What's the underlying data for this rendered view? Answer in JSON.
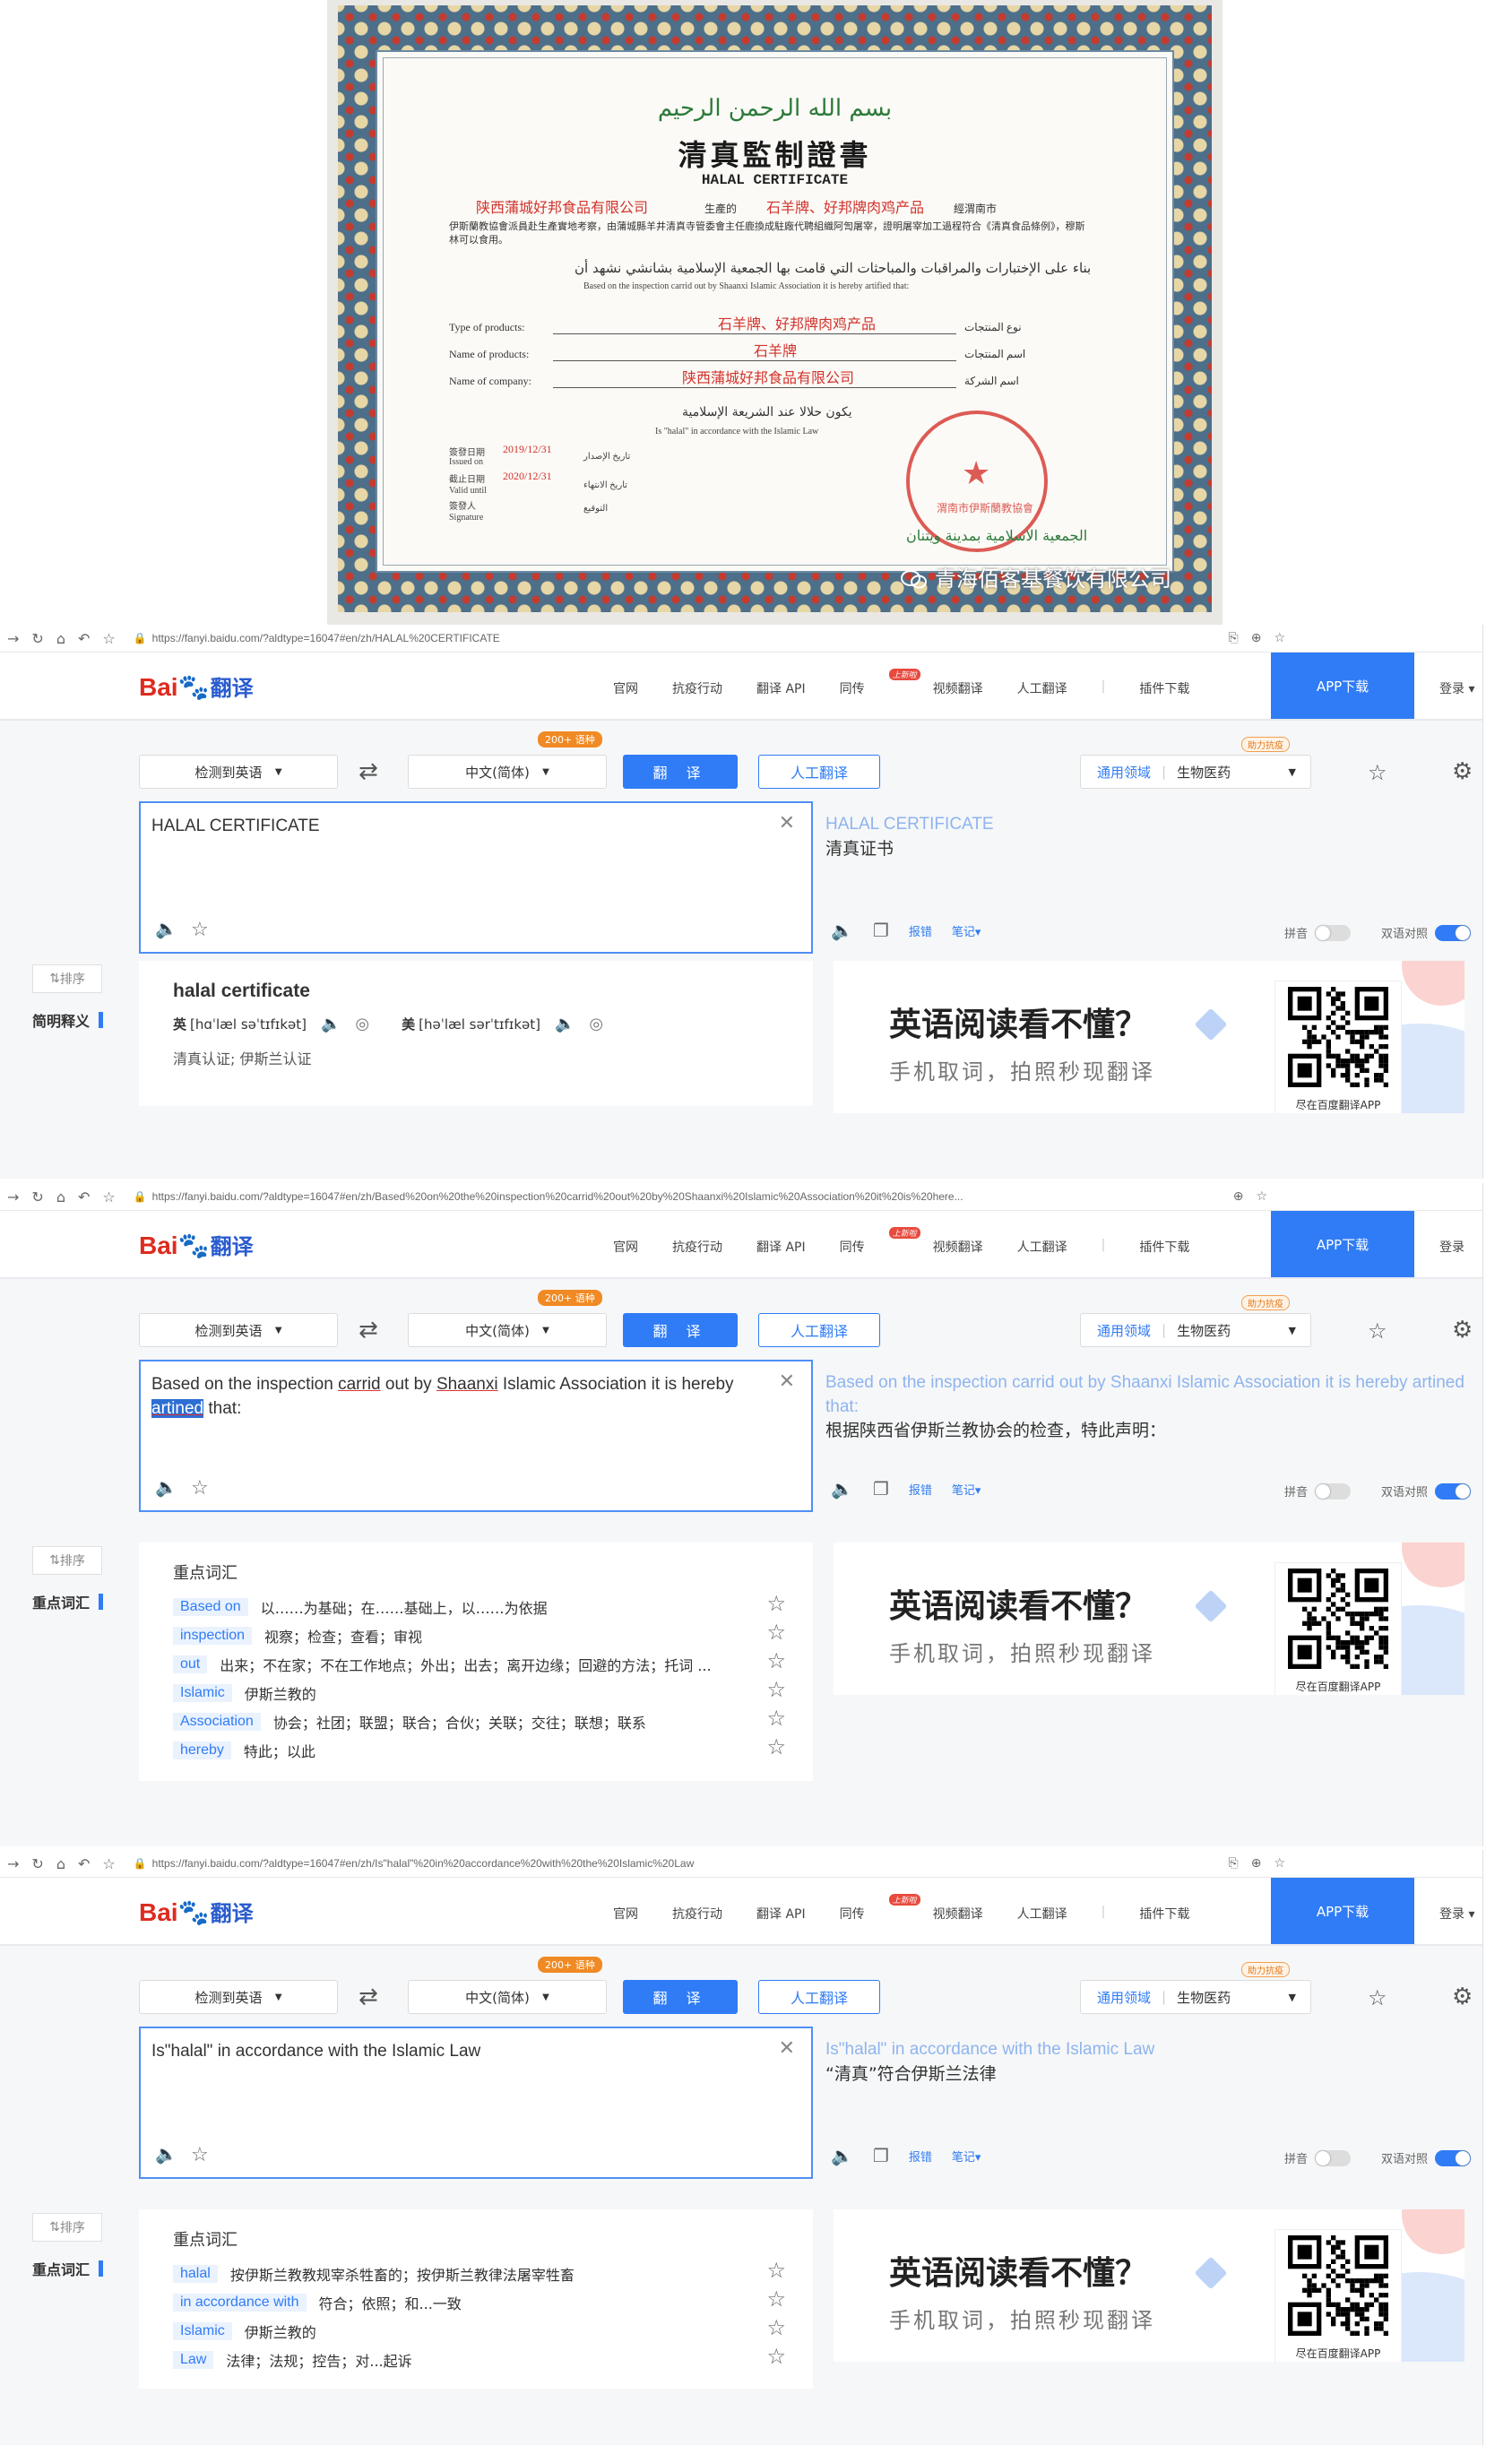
{
  "certificate": {
    "arabic_basmala": "بسم الله الرحمن الرحيم",
    "title_cn": "清真監制證書",
    "title_en": "HALAL CERTIFICATE",
    "company_cn": "陕西蒲城好邦食品有限公司",
    "producer_label": "生產的",
    "product_cn": "石羊牌、好邦牌肉鸡产品",
    "region_label": "經渭南市",
    "body_cn": "伊斯蘭教協會派員赴生產實地考察，由蒲城縣羊井清真寺管委會主任鹿換成駐廠代聘組織阿訇屠宰，證明屠宰加工過程符合《清真食品條例》，穆斯林可以食用。",
    "arabic_line": "بناء على الإختبارات والمراقبات والمباحثات التي قامت بها الجمعية الإسلامية بشانشي نشهد أن",
    "based_on_en": "Based on the inspection carrid out by Shaanxi Islamic Association it is hereby artified that:",
    "type_label": "Type of products:",
    "type_value": "石羊牌、好邦牌肉鸡产品",
    "type_ar": "نوع المنتجات",
    "name_label": "Name of products:",
    "name_value": "石羊牌",
    "name_ar": "اسم المنتجات",
    "company_label": "Name of company:",
    "company_value": "陕西蒲城好邦食品有限公司",
    "company_ar": "اسم الشركة",
    "halal_ar": "يكون حلالا عند الشريعة الإسلامية",
    "halal_en": "Is \"halal\" in accordance with the Islamic Law",
    "issue_label": "簽發日期",
    "issue_date": "2019/12/31",
    "issued_on": "Issued on",
    "issue_ar": "تاريخ الإصدار",
    "expire_label": "截止日期",
    "expire_date": "2020/12/31",
    "valid_until": "Valid until",
    "expire_ar": "تاريخ الانتهاء",
    "signer_label": "簽發人",
    "signature": "Signature",
    "signature_ar": "التوقيع",
    "stamp_text": "渭南市伊斯蘭教協會",
    "stamp_ar": "الجمعية الاسلامية بمدينة ويتنان",
    "watermark": "青海佰客基餐饮有限公司"
  },
  "common": {
    "logo_bai": "Bai",
    "logo_du": "du",
    "logo_fy": "翻译",
    "menu": [
      "官网",
      "抗疫行动",
      "翻译 API",
      "同传",
      "视频翻译",
      "人工翻译",
      "|",
      "插件下载"
    ],
    "new_badge": "上新啦",
    "app_download": "APP下载",
    "login": "登录",
    "detect": "检测到英语",
    "target_lang": "中文(简体)",
    "badge_200": "200+ 语种",
    "translate_btn": "翻 译",
    "human_btn": "人工翻译",
    "domain_label": "通用领域",
    "domain_value": "生物医药",
    "help_badge": "助力抗疫",
    "report": "报错",
    "notes": "笔记",
    "pinyin": "拼音",
    "bilingual": "双语对照",
    "sort": "排序",
    "ad_title": "英语阅读看不懂？",
    "ad_sub": "手机取词，拍照秒现翻译",
    "qr_caption": "尽在百度翻译APP",
    "kw_title": "重点词汇"
  },
  "panels": [
    {
      "url": "https://fanyi.baidu.com/?aldtype=16047#en/zh/HALAL%20CERTIFICATE",
      "source_text": "HALAL CERTIFICATE",
      "result_en": "HALAL CERTIFICATE",
      "result_cn": "清真证书",
      "side_label": "简明释义",
      "dict_word": "halal certificate",
      "phon_uk_label": "英",
      "phon_uk": "[hɑˈlæl səˈtɪfɪkət]",
      "phon_us_label": "美",
      "phon_us": "[həˈlæl sərˈtɪfɪkət]",
      "meaning": "清真认证;  伊斯兰认证"
    },
    {
      "url": "https://fanyi.baidu.com/?aldtype=16047#en/zh/Based%20on%20the%20inspection%20carrid%20out%20by%20Shaanxi%20Islamic%20Association%20it%20is%20here...",
      "source_a": "Based on the inspection ",
      "source_carrid": "carrid",
      "source_b": " out by ",
      "source_shaanxi": "Shaanxi",
      "source_c": " Islamic Association it is hereby",
      "source_artined": "artined",
      "source_d": " that:",
      "result_en": "Based on the inspection carrid out by Shaanxi Islamic Association it is hereby artined that:",
      "result_cn": "根据陕西省伊斯兰教协会的检查，特此声明：",
      "side_label": "重点词汇",
      "keywords": [
        {
          "word": "Based on",
          "def": "以……为基础；在……基础上，以……为依据"
        },
        {
          "word": "inspection",
          "def": "视察；检查；查看；审视"
        },
        {
          "word": "out",
          "def": "出来；不在家；不在工作地点；外出；出去；离开边缘；回避的方法；托词 ..."
        },
        {
          "word": "Islamic",
          "def": "伊斯兰教的"
        },
        {
          "word": "Association",
          "def": "协会；社团；联盟；联合；合伙；关联；交往；联想；联系"
        },
        {
          "word": "hereby",
          "def": "特此；以此"
        }
      ]
    },
    {
      "url": "https://fanyi.baidu.com/?aldtype=16047#en/zh/Is\"halal\"%20in%20accordance%20with%20the%20Islamic%20Law",
      "source_text": "Is\"halal\" in accordance with the Islamic Law",
      "result_en": "Is\"halal\" in accordance with the Islamic Law",
      "result_cn": "“清真”符合伊斯兰法律",
      "side_label": "重点词汇",
      "keywords": [
        {
          "word": "halal",
          "def": "按伊斯兰教教规宰杀牲畜的；按伊斯兰教律法屠宰牲畜"
        },
        {
          "word": "in accordance with",
          "def": "符合；依照；和...一致"
        },
        {
          "word": "Islamic",
          "def": "伊斯兰教的"
        },
        {
          "word": "Law",
          "def": "法律；法规；控告；对...起诉"
        }
      ]
    }
  ]
}
